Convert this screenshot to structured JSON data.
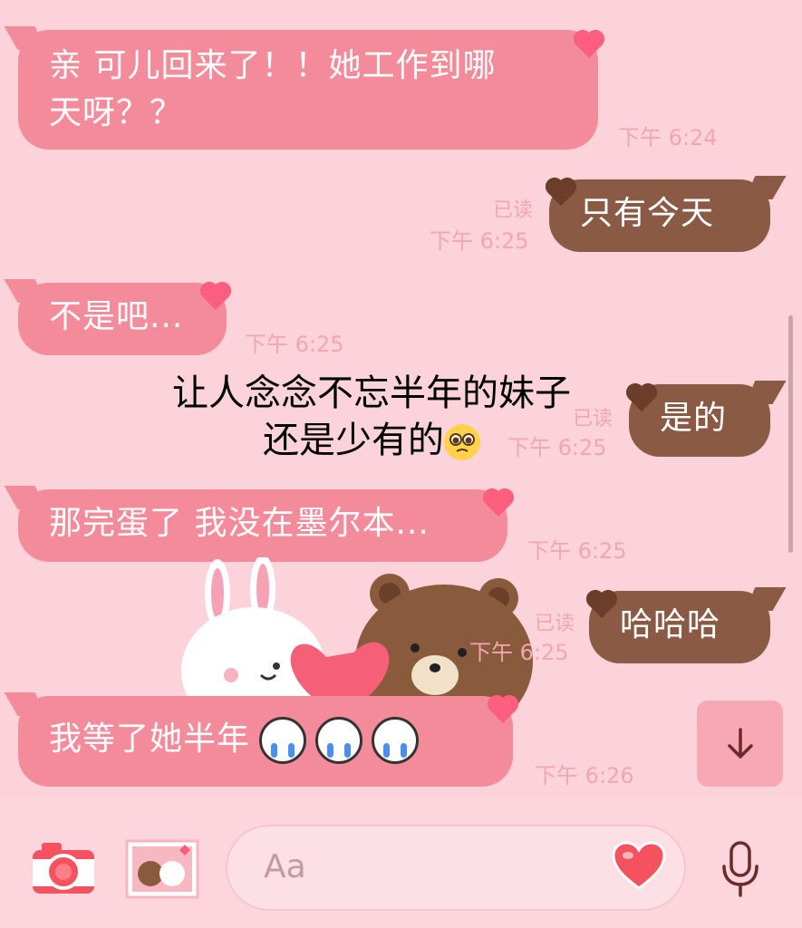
{
  "messages": [
    {
      "text": "亲 可儿回来了！！她工作到哪天呀？？",
      "line1": "亲 可儿回来了！！她工作到哪",
      "line2": "天呀？？",
      "time": "下午 6:24",
      "dir": "in"
    },
    {
      "text": "只有今天",
      "time": "下午 6:25",
      "read": "已读",
      "dir": "out"
    },
    {
      "text": "不是吧...",
      "time": "下午 6:25",
      "dir": "in"
    },
    {
      "text": "是的",
      "time": "下午 6:25",
      "read": "已读",
      "dir": "out"
    },
    {
      "text": "那完蛋了 我没在墨尔本...",
      "time": "下午 6:25",
      "dir": "in"
    },
    {
      "text": "哈哈哈",
      "time": "下午 6:25",
      "read": "已读",
      "dir": "out"
    },
    {
      "text": "我等了她半年",
      "time": "下午 6:26",
      "dir": "in",
      "emoji": [
        "crying-face",
        "crying-face",
        "crying-face"
      ]
    }
  ],
  "overlay": {
    "line1": "让人念念不忘半年的妹子",
    "line2": "还是少有的",
    "emoji": "pleading-face"
  },
  "composer": {
    "placeholder": "Aa",
    "icons": [
      "camera-icon",
      "sticker-icon",
      "heart-icon",
      "microphone-icon"
    ]
  },
  "scroll_button_icon": "arrow-down-icon",
  "colors": {
    "background": "#fcd3da",
    "incoming_bubble": "#f48b9b",
    "outgoing_bubble": "#8a5a44",
    "timestamp": "#f3a6b2"
  }
}
